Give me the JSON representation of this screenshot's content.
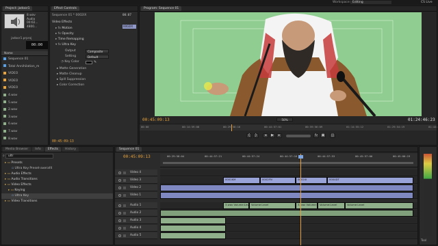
{
  "titlebar": {
    "workspace_label": "Workspace:",
    "workspace_value": "Editing",
    "cs_live": "CS Live"
  },
  "project": {
    "tab": "Project: jadoor1",
    "clip_name": "8.wav",
    "clip_type": "Audio",
    "clip_duration": "00:02...",
    "clip_rate": "4800...",
    "header_col1": "Name",
    "timecode": "00:00",
    "project_file": "jadoor1.prproj",
    "items": [
      {
        "name": "Sequence 01",
        "color": "#5aa0e6"
      },
      {
        "name": "Total Annihilation_m",
        "color": "#5aa0e6"
      },
      {
        "name": "VIDEO",
        "color": "#e8a33c"
      },
      {
        "name": "VIDEO",
        "color": "#e8a33c"
      },
      {
        "name": "VIDEO",
        "color": "#e8a33c"
      },
      {
        "name": "4.wav",
        "color": "#8fb08a"
      },
      {
        "name": "5.wav",
        "color": "#8fb08a"
      },
      {
        "name": "2.wav",
        "color": "#8fb08a"
      },
      {
        "name": "3.wav",
        "color": "#8fb08a"
      },
      {
        "name": "6.wav",
        "color": "#8fb08a"
      },
      {
        "name": "7.wav",
        "color": "#8fb08a"
      },
      {
        "name": "8.wav",
        "color": "#8fb08a"
      }
    ]
  },
  "effect_controls": {
    "tab": "Effect Controls",
    "sequence_label": "Sequence 01 * 0002IX",
    "mini_timecode": "00:07",
    "video_effects": "Video Effects",
    "motion": "Motion",
    "opacity": "Opacity",
    "time_remapping": "Time Remapping",
    "ultra_key": "Ultra Key",
    "output_label": "Output",
    "output_value": "Composite",
    "setting_label": "Setting",
    "setting_value": "Default",
    "key_color_label": "Key Color",
    "key_color_hex": "#000000",
    "matte_generation": "Matte Generation",
    "matte_cleanup": "Matte Cleanup",
    "spill_suppression": "Spill Suppression",
    "color_correction": "Color Correction",
    "timecode": "00:45:09:13",
    "clip_tag": "0002IX"
  },
  "program": {
    "tab": "Program: Sequence 01",
    "current_tc": "00:45:09:13",
    "fit": "50%",
    "duration_tc": "01:24:46:23",
    "ruler_labels": [
      "00:00",
      "00:14:59:08",
      "00:29:58:16",
      "00:44:57:01",
      "00:59:56:09",
      "01:14:55:12",
      "01:29:54:19",
      "01:44:54:03"
    ]
  },
  "effects_panel": {
    "tabs": [
      "Media Browser",
      "Info",
      "Effects",
      "History"
    ],
    "search_value": "ultr",
    "tree": [
      {
        "label": "Presets",
        "indent": 1,
        "kind": "folder"
      },
      {
        "label": "Ultra Key Preset-axeraf4",
        "indent": 3,
        "kind": "item"
      },
      {
        "label": "Audio Effects",
        "indent": 1,
        "kind": "folder"
      },
      {
        "label": "Audio Transitions",
        "indent": 1,
        "kind": "folder"
      },
      {
        "label": "Video Effects",
        "indent": 1,
        "kind": "folder"
      },
      {
        "label": "Keying",
        "indent": 2,
        "kind": "folder"
      },
      {
        "label": "Ultra Key",
        "indent": 3,
        "kind": "item-selected"
      },
      {
        "label": "Video Transitions",
        "indent": 1,
        "kind": "folder"
      }
    ]
  },
  "timeline": {
    "tab": "Sequence 01",
    "timecode": "00:45:09:13",
    "ruler_labels": [
      "00:29:58:04",
      "00:44:57:21",
      "00:44:57:24",
      "00:44:57:16",
      "00:44:57:53",
      "00:45:57:00",
      "00:45:00:19"
    ],
    "video_tracks": [
      "Video 4",
      "Video 3",
      "Video 2",
      "Video 1"
    ],
    "audio_tracks": [
      "Audio 1",
      "Audio 2",
      "Audio 3",
      "Audio 4",
      "Audio 5"
    ],
    "clips_v3": [
      "0001KM",
      "0002FN",
      "0002IX",
      "0004DT"
    ],
    "audio_clip_labels": [
      "3.wav Volume:Level",
      "Volume:Level",
      "3.wav Volume:Level",
      "Volume:Level",
      "Volume:Level"
    ]
  },
  "audio_meter": {
    "label": "Tool"
  },
  "colors": {
    "accent_orange": "#e8a33c",
    "video_clip": "#9aa3d8",
    "audio_clip": "#8fb08a",
    "green_screen": "#8cc98c"
  }
}
